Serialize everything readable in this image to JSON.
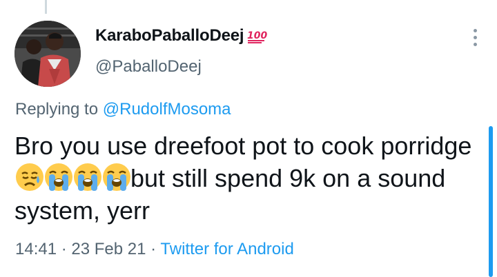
{
  "tweet": {
    "display_name": "KaraboPaballoDeej",
    "handle": "@PaballoDeej",
    "badge_icon": "hundred-points-icon",
    "replying_prefix": "Replying to",
    "replying_to": "@RudolfMosoma",
    "text_part1": "Bro you use dreefoot pot to cook porridge ",
    "emojis": [
      "disappointed-relieved-face",
      "loudly-crying-face",
      "loudly-crying-face",
      "loudly-crying-face"
    ],
    "text_part2": "but still spend 9k on a sound system, yerr",
    "time": "14:41",
    "separator": "·",
    "date": "23 Feb 21",
    "source": "Twitter for Android"
  },
  "colors": {
    "text": "#0f1419",
    "secondary": "#536471",
    "link": "#1d9bf0"
  }
}
